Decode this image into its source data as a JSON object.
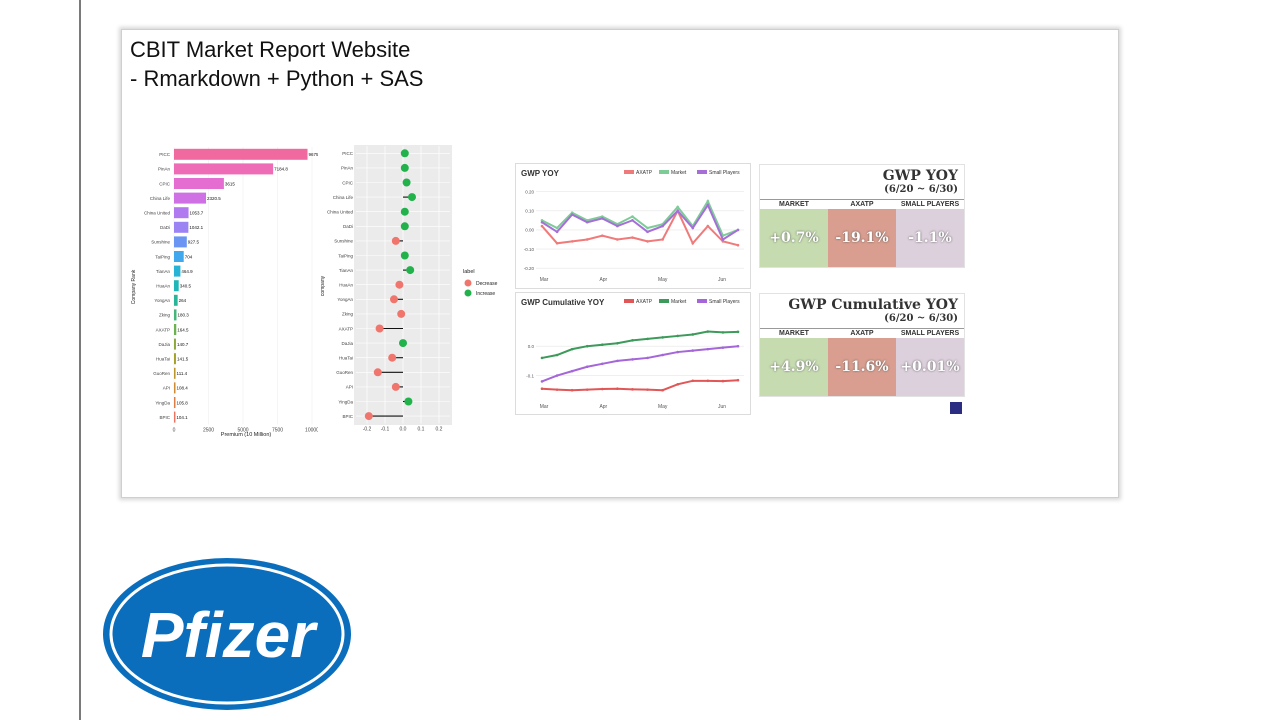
{
  "slide": {
    "title_line1": "CBIT Market Report Website",
    "title_line2": "- Rmarkdown + Python + SAS",
    "logo_text": "Pfizer",
    "logo_color": "#0a6ebd"
  },
  "chart_data": [
    {
      "type": "bar",
      "orientation": "horizontal",
      "ylabel": "Company Rank",
      "xlabel": "Premium (10 Million)",
      "xlim": [
        0,
        10000
      ],
      "xticks": [
        "0",
        "2500",
        "5000",
        "7500",
        "10000"
      ],
      "categories": [
        "PICC",
        "PinAn",
        "CPIC",
        "China Life",
        "China United",
        "DaDi",
        "Sunshine",
        "TaiPing",
        "TianAn",
        "HuaAn",
        "YongAn",
        "Zking",
        "AXATP",
        "DaJia",
        "HuaTai",
        "GuoRen",
        "API",
        "YingDa",
        "BPIC"
      ],
      "values": [
        9675.3,
        7184.8,
        3615,
        2320.5,
        1053.7,
        1042.1,
        927.5,
        704,
        464.9,
        340.5,
        264,
        180.3,
        164.5,
        140.7,
        141.5,
        111.4,
        108.4,
        105.8,
        104.1
      ],
      "value_labels": [
        "9675.3",
        "7184.8",
        "3615",
        "2320.5",
        "1053.7",
        "1042.1",
        "927.5",
        "704",
        "464.9",
        "340.5",
        "264",
        "180.3",
        "164.5",
        "140.7",
        "141.5",
        "111.4",
        "108.4",
        "105.8",
        "104.1"
      ],
      "colors": [
        "#f06aa0",
        "#ee6bb6",
        "#e56cd0",
        "#cf70e4",
        "#b079ef",
        "#9b83f3",
        "#6a95f3",
        "#41a8ee",
        "#27b3d6",
        "#1fb6b8",
        "#2ab59b",
        "#45b57c",
        "#6cb04f",
        "#8ca83a",
        "#a6a02b",
        "#bb962a",
        "#cf8a34",
        "#e07d45",
        "#ec7360"
      ]
    },
    {
      "type": "scatter",
      "ylabel": "company",
      "xlim": [
        -0.25,
        0.25
      ],
      "xticks": [
        "-0.2",
        "-0.1",
        "0.0",
        "0.1",
        "0.2"
      ],
      "categories": [
        "PICC",
        "PinAn",
        "CPIC",
        "China Life",
        "China United",
        "DaDi",
        "Sunshine",
        "TaiPing",
        "TianAn",
        "HuaAn",
        "YongAn",
        "Zking",
        "AXATP",
        "DaJia",
        "HuaTai",
        "GuoRen",
        "API",
        "YingDa",
        "BPIC"
      ],
      "values": [
        0.01,
        0.01,
        0.02,
        0.05,
        0.01,
        0.01,
        -0.04,
        0.01,
        0.04,
        -0.02,
        -0.05,
        -0.01,
        -0.13,
        0.0,
        -0.06,
        -0.14,
        -0.04,
        0.03,
        -0.19
      ],
      "legend": {
        "title": "label",
        "items": [
          "Decrease",
          "Increase"
        ]
      },
      "series_colors": {
        "Decrease": "#f0766d",
        "Increase": "#22b24c"
      }
    },
    {
      "type": "line",
      "title": "GWP YOY",
      "x_ticks": [
        "Mar",
        "Apr",
        "May",
        "Jun"
      ],
      "y_ticks": [
        "0.20",
        "0.10",
        "0.00",
        "-0.10",
        "-0.20"
      ],
      "ylim": [
        -0.22,
        0.24
      ],
      "series": [
        {
          "name": "AXATP",
          "color": "#f07a7a",
          "values": [
            0.02,
            -0.07,
            -0.06,
            -0.05,
            -0.03,
            -0.05,
            -0.04,
            -0.06,
            -0.05,
            0.1,
            -0.07,
            0.02,
            -0.06,
            -0.08
          ]
        },
        {
          "name": "Market",
          "color": "#7dcc98",
          "values": [
            0.05,
            0.01,
            0.09,
            0.05,
            0.07,
            0.03,
            0.07,
            0.01,
            0.03,
            0.12,
            0.02,
            0.15,
            -0.03,
            0.0
          ]
        },
        {
          "name": "Small Players",
          "color": "#a66fd8",
          "values": [
            0.04,
            -0.01,
            0.08,
            0.04,
            0.06,
            0.02,
            0.05,
            -0.01,
            0.02,
            0.1,
            0.01,
            0.13,
            -0.05,
            0.0
          ]
        }
      ]
    },
    {
      "type": "line",
      "title": "GWP Cumulative YOY",
      "x_ticks": [
        "Mar",
        "Apr",
        "May",
        "Jun"
      ],
      "y_ticks": [
        "0.0",
        "-0.1"
      ],
      "ylim": [
        -0.18,
        0.12
      ],
      "series": [
        {
          "name": "AXATP",
          "color": "#e15757",
          "values": [
            -0.145,
            -0.148,
            -0.15,
            -0.148,
            -0.146,
            -0.145,
            -0.147,
            -0.148,
            -0.15,
            -0.13,
            -0.118,
            -0.118,
            -0.119,
            -0.116
          ]
        },
        {
          "name": "Market",
          "color": "#3c9a5a",
          "values": [
            -0.04,
            -0.03,
            -0.01,
            0.0,
            0.005,
            0.01,
            0.02,
            0.025,
            0.03,
            0.035,
            0.04,
            0.05,
            0.047,
            0.049
          ]
        },
        {
          "name": "Small Players",
          "color": "#a466d8",
          "values": [
            -0.12,
            -0.1,
            -0.085,
            -0.07,
            -0.06,
            -0.05,
            -0.045,
            -0.04,
            -0.03,
            -0.02,
            -0.015,
            -0.01,
            -0.005,
            0.0
          ]
        }
      ]
    }
  ],
  "gwp_yoy": {
    "title": "GWP YOY",
    "subtitle": "(6/20 ~ 6/30)",
    "columns": [
      "MARKET",
      "AXATP",
      "SMALL PLAYERS"
    ],
    "values": [
      "+0.7%",
      "-19.1%",
      "-1.1%"
    ],
    "colors": [
      "#c6dcb0",
      "#d99e8f",
      "#ddd0dd"
    ]
  },
  "gwp_cum": {
    "title": "GWP Cumulative YOY",
    "subtitle": "(6/20 ~ 6/30)",
    "columns": [
      "MARKET",
      "AXATP",
      "SMALL PLAYERS"
    ],
    "values": [
      "+4.9%",
      "-11.6%",
      "+0.01%"
    ],
    "colors": [
      "#c6dcb0",
      "#d99e8f",
      "#ddd0dd"
    ]
  },
  "brand": {
    "axa_color": "#2b2d83"
  }
}
